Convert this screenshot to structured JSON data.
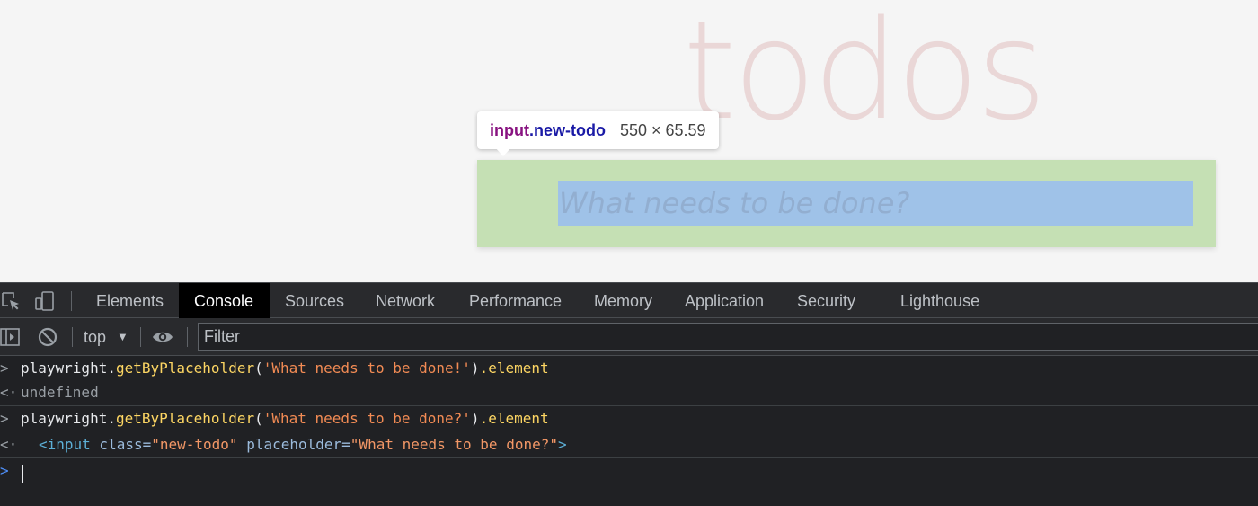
{
  "app": {
    "heading": "todos",
    "input_placeholder": "What needs to be done?"
  },
  "inspector_tooltip": {
    "tag": "input",
    "class_name": ".new-todo",
    "dimensions": "550 × 65.59"
  },
  "devtools": {
    "tabs": [
      {
        "label": "Elements"
      },
      {
        "label": "Console"
      },
      {
        "label": "Sources"
      },
      {
        "label": "Network"
      },
      {
        "label": "Performance"
      },
      {
        "label": "Memory"
      },
      {
        "label": "Application"
      },
      {
        "label": "Security"
      },
      {
        "label": "Lighthouse"
      }
    ],
    "active_tab": "Console",
    "context": "top",
    "filter_placeholder": "Filter",
    "console": {
      "entries": [
        {
          "type": "input",
          "obj": "playwright",
          "dot1": ".",
          "method": "getByPlaceholder",
          "paren_open": "(",
          "arg": "'What needs to be done!'",
          "paren_close": ")",
          "prop": ".element"
        },
        {
          "type": "output",
          "value": "undefined"
        },
        {
          "type": "input",
          "obj": "playwright",
          "dot1": ".",
          "method": "getByPlaceholder",
          "paren_open": "(",
          "arg": "'What needs to be done?'",
          "paren_close": ")",
          "prop": ".element"
        },
        {
          "type": "output",
          "tag_open": "<input",
          "attr1_name": " class=",
          "attr1_value": "\"new-todo\"",
          "attr2_name": " placeholder=",
          "attr2_value": "\"What needs to be done?\"",
          "tag_close": ">"
        }
      ]
    }
  },
  "icons": {
    "inspect": "inspect-element-icon",
    "device": "device-toolbar-icon",
    "sidebar": "console-sidebar-icon",
    "clear": "clear-console-icon",
    "eye": "live-expression-eye-icon"
  },
  "colors": {
    "todos_heading": "#efd5d5",
    "margin_highlight": "#c5e0b4",
    "content_highlight": "#9fc2e8",
    "devtools_bg": "#202124",
    "string_color": "#f28b54",
    "function_color": "#fdd663"
  }
}
